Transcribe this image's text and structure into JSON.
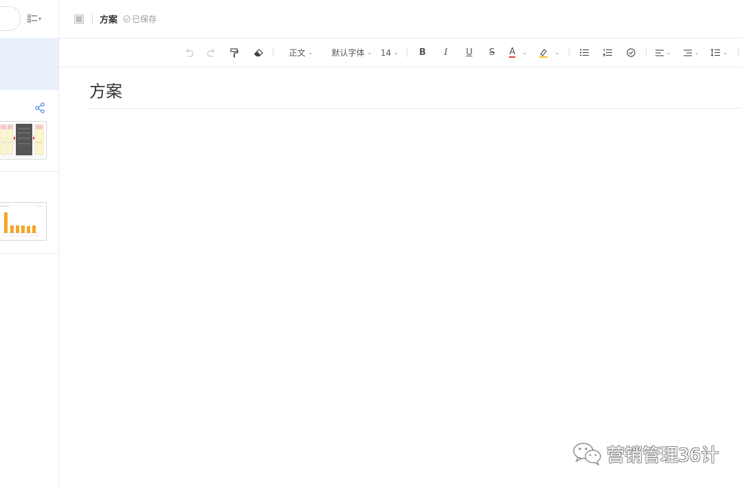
{
  "header": {
    "title": "方案",
    "saved_status": "已保存"
  },
  "toolbar": {
    "paragraph_style": "正文",
    "font_family": "默认字体",
    "font_size": "14",
    "bold": "B",
    "italic": "I",
    "underline": "U",
    "strike": "S",
    "font_color_glyph": "A",
    "colors": {
      "font_color": "#e53935",
      "highlight": "#f5c518",
      "accent": "#4a86e8"
    }
  },
  "editor": {
    "title": "方案"
  },
  "sidebar": {
    "active_item_color": "#eaf0fb",
    "cards": [
      {
        "name": "process-diagram-thumbnail"
      },
      {
        "name": "bar-chart-thumbnail"
      }
    ]
  },
  "watermark": {
    "text": "营销管理36计"
  },
  "icons": [
    "undo-icon",
    "redo-icon",
    "format-painter-icon",
    "eraser-icon",
    "bullet-list-icon",
    "numbered-list-icon",
    "checklist-icon",
    "align-icon",
    "indent-icon",
    "line-height-icon",
    "share-icon",
    "doc-icon",
    "view-toggle-icon",
    "wechat-icon"
  ]
}
